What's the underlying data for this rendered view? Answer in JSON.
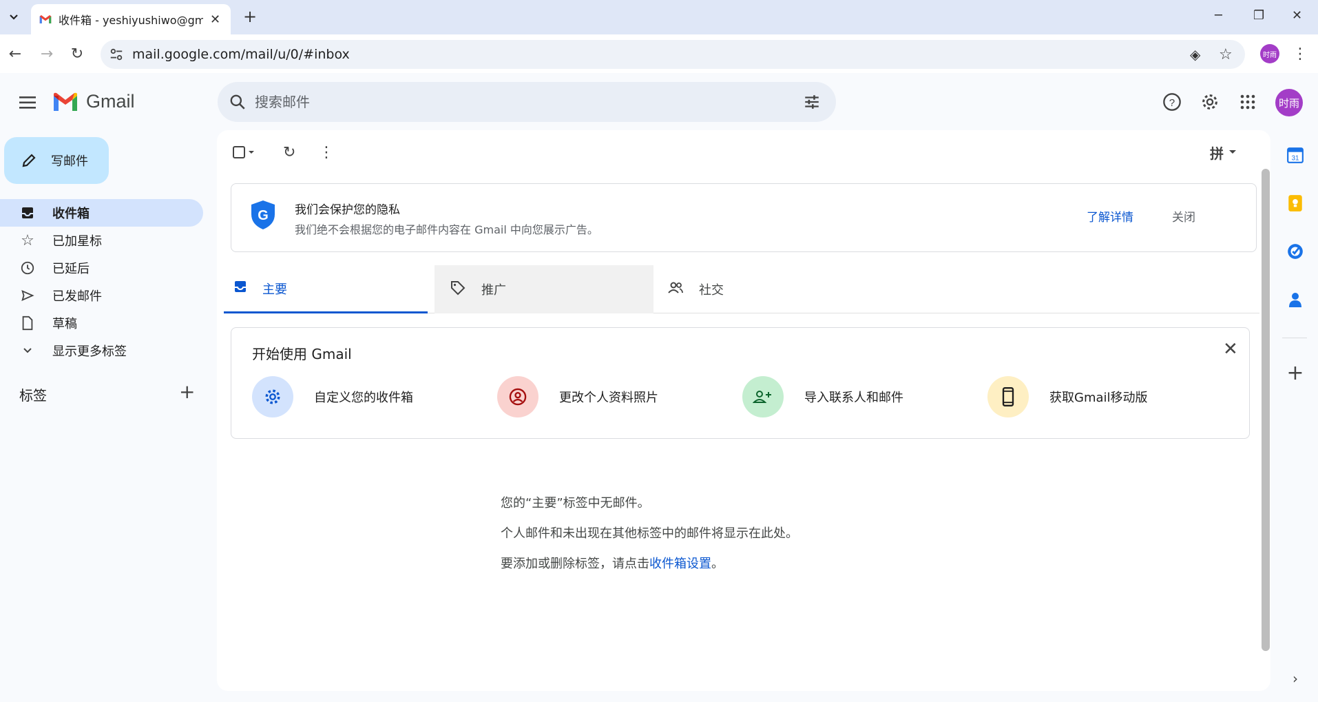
{
  "browser": {
    "tab_title": "收件箱 - yeshiyushiwo@gmail",
    "url": "mail.google.com/mail/u/0/#inbox",
    "profile_initials": "时雨"
  },
  "header": {
    "app_name": "Gmail",
    "search_placeholder": "搜索邮件",
    "avatar_initials": "时雨"
  },
  "sidebar": {
    "compose_label": "写邮件",
    "items": [
      {
        "label": "收件箱",
        "icon": "inbox-icon",
        "active": true
      },
      {
        "label": "已加星标",
        "icon": "star-icon"
      },
      {
        "label": "已延后",
        "icon": "clock-icon"
      },
      {
        "label": "已发邮件",
        "icon": "send-icon"
      },
      {
        "label": "草稿",
        "icon": "draft-icon"
      },
      {
        "label": "显示更多标签",
        "icon": "chevron-down-icon"
      }
    ],
    "labels_title": "标签"
  },
  "toolbar": {
    "input_tool": "拼"
  },
  "privacy_banner": {
    "title": "我们会保护您的隐私",
    "subtitle": "我们绝不会根据您的电子邮件内容在 Gmail 中向您展示广告。",
    "learn_more": "了解详情",
    "close": "关闭"
  },
  "category_tabs": [
    {
      "label": "主要",
      "icon": "inbox-icon"
    },
    {
      "label": "推广",
      "icon": "tag-icon"
    },
    {
      "label": "社交",
      "icon": "people-icon"
    }
  ],
  "get_started": {
    "title": "开始使用 Gmail",
    "items": [
      {
        "label": "自定义您的收件箱",
        "icon": "gear-icon",
        "color": "#d3e3fd"
      },
      {
        "label": "更改个人资料照片",
        "icon": "account-circle-icon",
        "color": "#fad2cf"
      },
      {
        "label": "导入联系人和邮件",
        "icon": "person-add-icon",
        "color": "#c4eed0"
      },
      {
        "label": "获取Gmail移动版",
        "icon": "phone-icon",
        "color": "#feefc3"
      }
    ]
  },
  "empty_state": {
    "line1": "您的“主要”标签中无邮件。",
    "line2": "个人邮件和未出现在其他标签中的邮件将显示在此处。",
    "line3_prefix": "要添加或删除标签，请点击",
    "line3_link": "收件箱设置",
    "line3_suffix": "。"
  },
  "side_panel": {
    "calendar_day": "31"
  }
}
